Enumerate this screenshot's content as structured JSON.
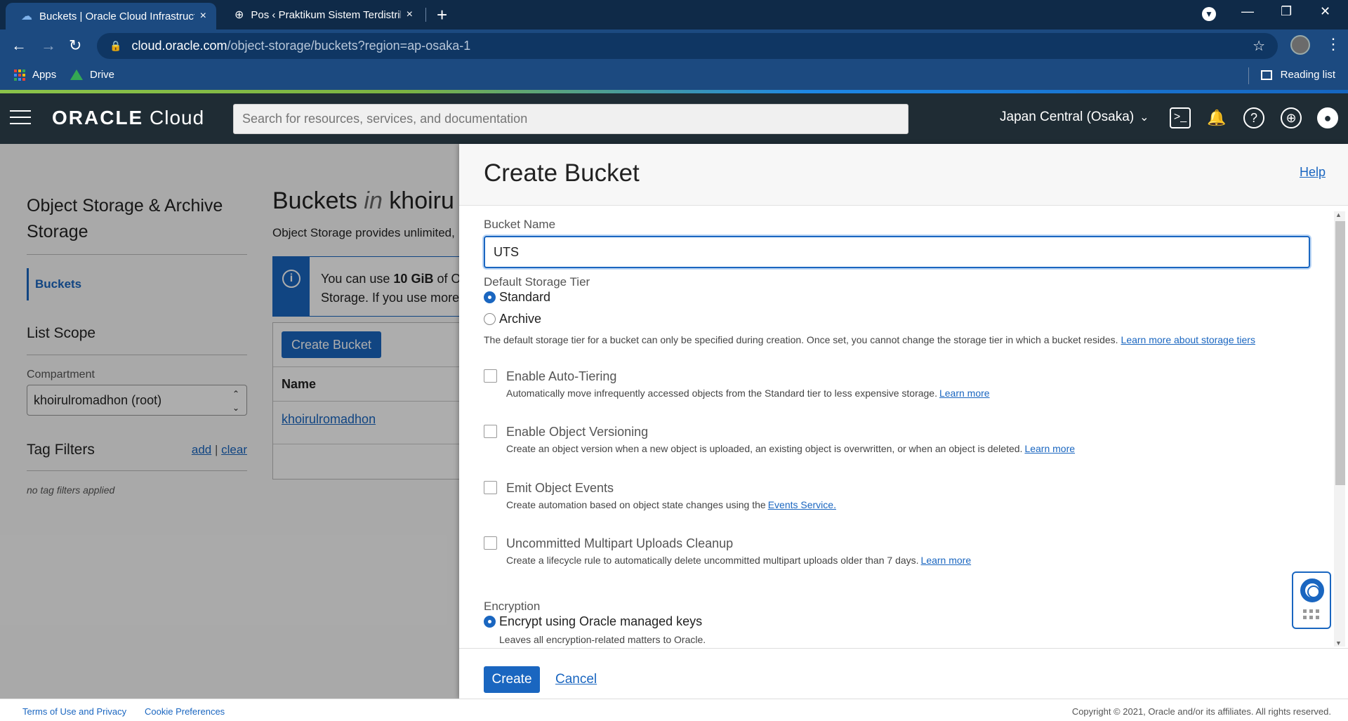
{
  "browser": {
    "tabs": [
      {
        "title": "Buckets | Oracle Cloud Infrastructu",
        "close": "×"
      },
      {
        "title": "Pos ‹ Praktikum Sistem Terdistribu",
        "close": "×"
      }
    ],
    "new_tab": "+",
    "url_host": "cloud.oracle.com",
    "url_path": "/object-storage/buckets?region=ap-osaka-1",
    "bookmarks": [
      {
        "label": "Apps"
      },
      {
        "label": "Drive"
      }
    ],
    "reading_list": "Reading list"
  },
  "oracle_header": {
    "logo_brand": "ORACLE",
    "logo_product": " Cloud",
    "search_placeholder": "Search for resources, services, and documentation",
    "region": "Japan Central (Osaka)"
  },
  "sidebar": {
    "title": "Object Storage & Archive Storage",
    "active_item": "Buckets",
    "list_scope_heading": "List Scope",
    "compartment_label": "Compartment",
    "compartment_value": "khoirulromadhon (root)",
    "tag_filters_heading": "Tag Filters",
    "tag_add": "add",
    "tag_sep": " | ",
    "tag_clear": "clear",
    "no_tags": "no tag filters applied"
  },
  "main": {
    "title_prefix": "Buckets ",
    "title_in": "in",
    "title_suffix": " khoiru",
    "description": "Object Storage provides unlimited,",
    "info_pre": "You can use ",
    "info_bold": "10 GiB",
    "info_post": " of O",
    "info_line2": "Storage. If you use more",
    "create_button": "Create Bucket",
    "table_header_name": "Name",
    "table_rows": [
      {
        "name": "khoirulromadhon"
      }
    ]
  },
  "panel": {
    "title": "Create Bucket",
    "help": "Help",
    "bucket_name_label": "Bucket Name",
    "bucket_name_value": "UTS",
    "storage_tier_label": "Default Storage Tier",
    "tier_options": [
      {
        "label": "Standard",
        "selected": true
      },
      {
        "label": "Archive",
        "selected": false
      }
    ],
    "tier_help": "The default storage tier for a bucket can only be specified during creation. Once set, you cannot change the storage tier in which a bucket resides.",
    "tier_help_link": "Learn more about storage tiers",
    "checkboxes": [
      {
        "label": "Enable Auto-Tiering",
        "help": "Automatically move infrequently accessed objects from the Standard tier to less expensive storage.",
        "link": "Learn more"
      },
      {
        "label": "Enable Object Versioning",
        "help": "Create an object version when a new object is uploaded, an existing object is overwritten, or when an object is deleted.",
        "link": "Learn more"
      },
      {
        "label": "Emit Object Events",
        "help": "Create automation based on object state changes using the",
        "link": "Events Service."
      },
      {
        "label": "Uncommitted Multipart Uploads Cleanup",
        "help": "Create a lifecycle rule to automatically delete uncommitted multipart uploads older than 7 days.",
        "link": "Learn more"
      }
    ],
    "encryption_label": "Encryption",
    "encryption_option": "Encrypt using Oracle managed keys",
    "encryption_help": "Leaves all encryption-related matters to Oracle.",
    "create_button": "Create",
    "cancel_link": "Cancel"
  },
  "footer": {
    "terms": "Terms of Use and Privacy",
    "cookies": "Cookie Preferences",
    "copyright": "Copyright © 2021, Oracle and/or its affiliates. All rights reserved."
  },
  "colors": {
    "accent": "#1a66c0",
    "header": "#1f2c34",
    "browser_frame": "#1c4a80"
  }
}
